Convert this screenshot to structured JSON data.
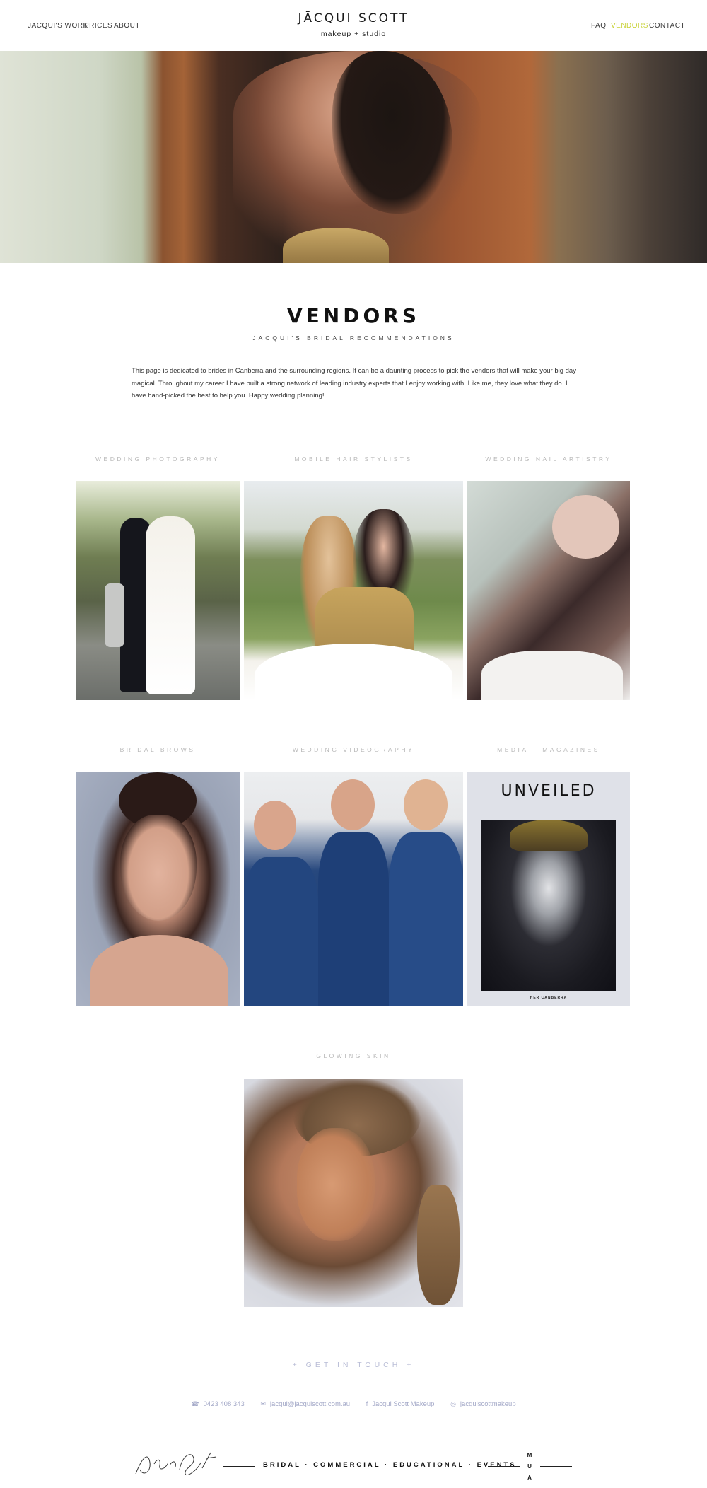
{
  "header": {
    "nav_left": [
      "JACQUI'S WORK",
      "PRICES",
      "ABOUT"
    ],
    "logo_main": "JĀCQUI SCOTT",
    "logo_sub": "makeup + studio",
    "nav_right": [
      "FAQ",
      "VENDORS",
      "CONTACT"
    ],
    "active_nav": "VENDORS",
    "accent_color": "#c9d33a"
  },
  "page": {
    "title": "VENDORS",
    "subtitle": "JACQUI'S BRIDAL RECOMMENDATIONS",
    "intro": "This page is dedicated to brides in Canberra and the surrounding regions. It can be a daunting process to pick the vendors that will make your big day magical. Throughout my career I have built a strong network of leading industry experts that I enjoy working with. Like me, they love what they do. I have hand-picked the best to help you. Happy wedding planning!"
  },
  "categories": [
    {
      "label": "WEDDING PHOTOGRAPHY"
    },
    {
      "label": "MOBILE HAIR STYLISTS"
    },
    {
      "label": "WEDDING NAIL ARTISTRY"
    },
    {
      "label": "BRIDAL BROWS"
    },
    {
      "label": "WEDDING VIDEOGRAPHY"
    },
    {
      "label": "MEDIA + MAGAZINES"
    },
    {
      "label": "GLOWING SKIN"
    }
  ],
  "magazine": {
    "title": "UNVEILED",
    "footer": "HER CANBERRA"
  },
  "contact": {
    "cta": "+ GET IN TOUCH +",
    "phone": "0423 408 343",
    "email": "jacqui@jacquiscott.com.au",
    "facebook": "Jacqui Scott Makeup",
    "instagram": "jacquiscottmakeup",
    "link_color": "#a4a9c8"
  },
  "footer": {
    "tagline": "BRIDAL · COMMERCIAL · EDUCATIONAL · EVENTS",
    "mua": [
      "M",
      "U",
      "A"
    ]
  }
}
